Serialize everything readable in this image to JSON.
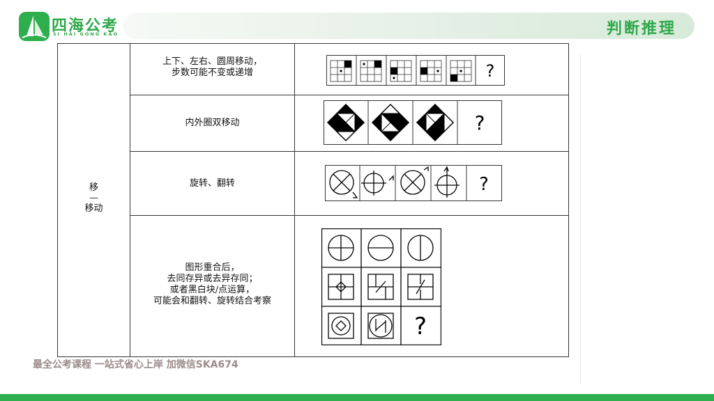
{
  "brand": {
    "name": "四海公考",
    "subtitle": "SI HAI GONG KAO",
    "primary_color": "#2fa84d"
  },
  "header": {
    "title": "判断推理"
  },
  "table": {
    "category": {
      "line1": "移",
      "line2": "—",
      "line3": "移动"
    },
    "rows": [
      {
        "description": "上下、左右、圆周移动，",
        "description2": "步数可能不变或递增",
        "figure": "grid-dots-sequence",
        "question_mark": "?"
      },
      {
        "description": "内外圈双移动",
        "figure": "diamond-triangles-sequence",
        "question_mark": "?"
      },
      {
        "description": "旋转、翻转",
        "figure": "circle-cross-rotation-sequence",
        "question_mark": "?"
      },
      {
        "description": "图形重合后，",
        "description2": "去同存异或去异存同；",
        "description3": "或者黑白块/点运算，",
        "description4": "可能会和翻转、旋转结合考察",
        "figure": "overlay-3x3-grid",
        "question_mark": "?"
      }
    ]
  },
  "footer": {
    "watermark": "最全公考课程 一站式省心上岸 加微信SKA674"
  }
}
